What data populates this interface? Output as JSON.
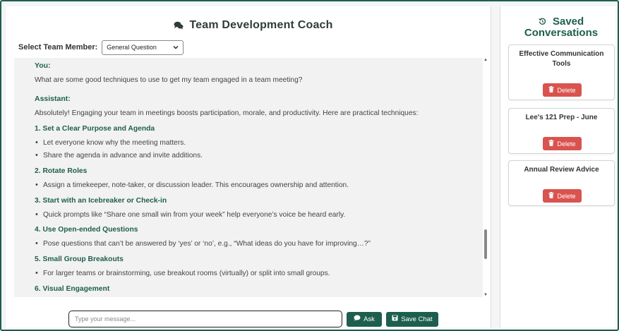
{
  "header": {
    "title": "Team Development Coach",
    "icon": "comments-icon"
  },
  "member_select": {
    "label": "Select Team Member:",
    "value": "General Question"
  },
  "chat": {
    "you_label": "You:",
    "user_message": "What are some good techniques to use to get my team engaged in a team meeting?",
    "assistant_label": "Assistant:",
    "intro": "Absolutely! Engaging your team in meetings boosts participation, morale, and productivity. Here are practical techniques:",
    "sections": [
      {
        "heading": "1. Set a Clear Purpose and Agenda",
        "bullets": [
          "Let everyone know why the meeting matters.",
          "Share the agenda in advance and invite additions."
        ]
      },
      {
        "heading": "2. Rotate Roles",
        "bullets": [
          "Assign a timekeeper, note-taker, or discussion leader. This encourages ownership and attention."
        ]
      },
      {
        "heading": "3. Start with an Icebreaker or Check-in",
        "bullets": [
          "Quick prompts like “Share one small win from your week” help everyone’s voice be heard early."
        ]
      },
      {
        "heading": "4. Use Open-ended Questions",
        "bullets": [
          "Pose questions that can’t be answered by ‘yes’ or ‘no’, e.g., “What ideas do you have for improving…?”"
        ]
      },
      {
        "heading": "5. Small Group Breakouts",
        "bullets": [
          "For larger teams or brainstorming, use breakout rooms (virtually) or split into small groups."
        ]
      },
      {
        "heading": "6. Visual Engagement",
        "bullets": []
      }
    ]
  },
  "composer": {
    "placeholder": "Type your message...",
    "ask_label": "Ask",
    "save_label": "Save Chat"
  },
  "sidebar": {
    "title_line1": "Saved",
    "title_line2": "Conversations",
    "conversations": [
      {
        "title": "Effective Communication Tools",
        "delete_label": "Delete"
      },
      {
        "title": "Lee's 121 Prep - June",
        "delete_label": "Delete"
      },
      {
        "title": "Annual Review Advice",
        "delete_label": "Delete"
      }
    ]
  },
  "colors": {
    "accent": "#1e5e4e",
    "danger": "#d9534f"
  }
}
